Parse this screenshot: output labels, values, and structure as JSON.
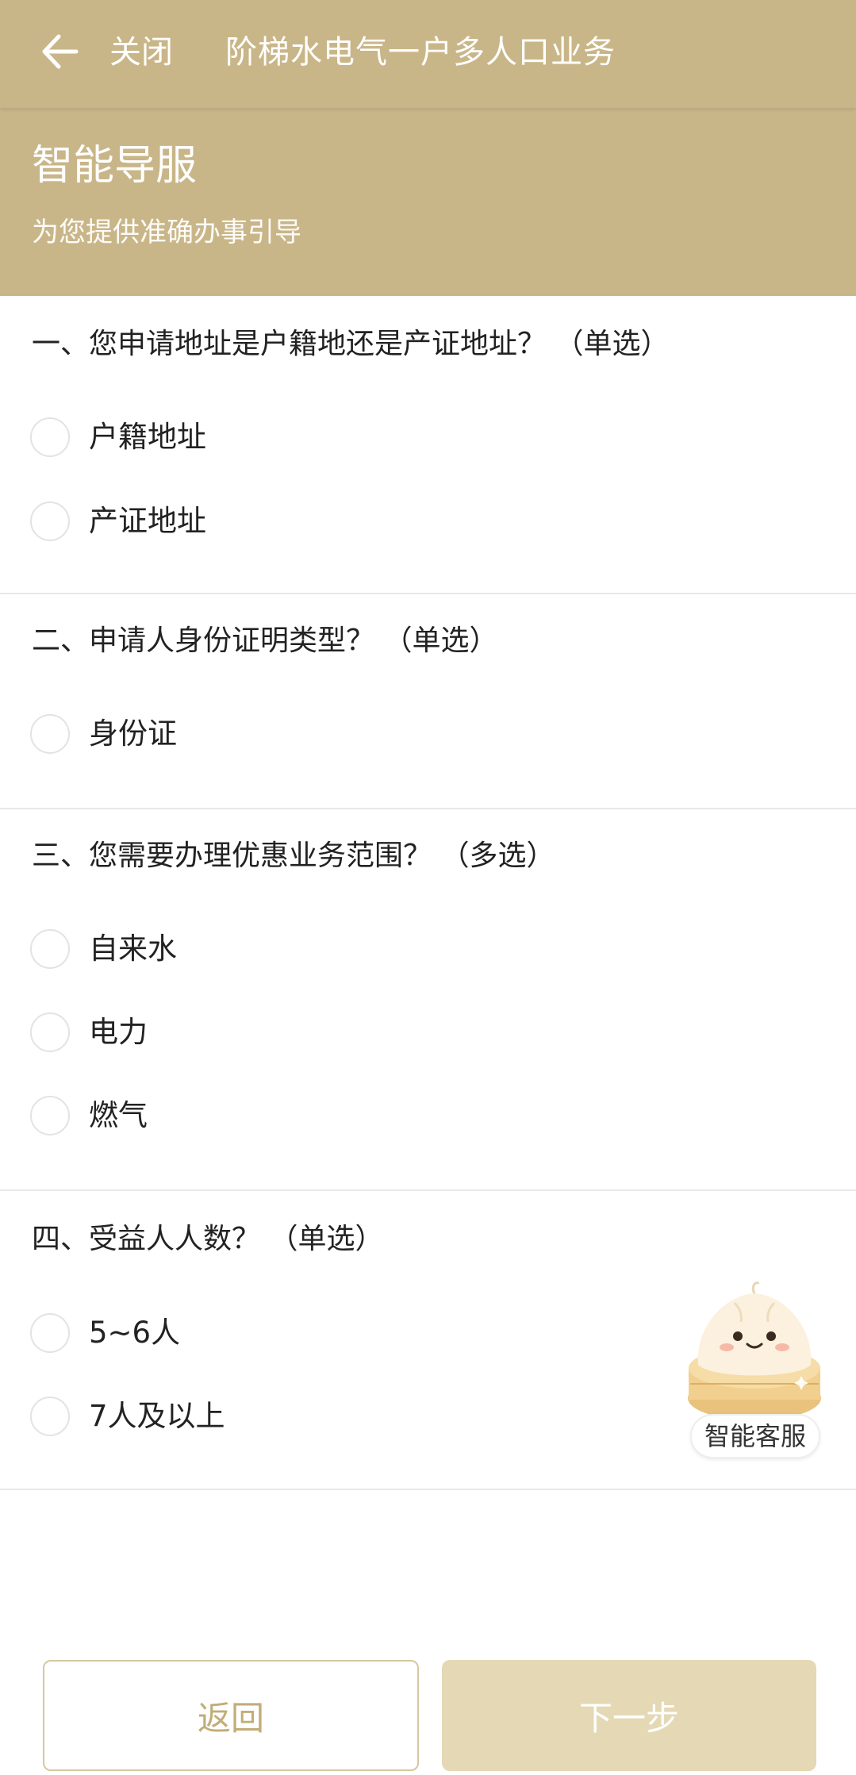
{
  "header": {
    "close_label": "关闭",
    "title": "阶梯水电气一户多人口业务",
    "back_icon": "arrow-left-icon"
  },
  "hero": {
    "title": "智能导服",
    "subtitle": "为您提供准确办事引导"
  },
  "questions": [
    {
      "title": "一、您申请地址是户籍地还是产证地址？ （单选）",
      "options": [
        "户籍地址",
        "产证地址"
      ]
    },
    {
      "title": "二、申请人身份证明类型？ （单选）",
      "options": [
        "身份证"
      ]
    },
    {
      "title": "三、您需要办理优惠业务范围？ （多选）",
      "options": [
        "自来水",
        "电力",
        "燃气"
      ]
    },
    {
      "title": "四、受益人人数？ （单选）",
      "options": [
        "5~6人",
        "7人及以上"
      ]
    }
  ],
  "assistant": {
    "label": "智能客服",
    "icon": "steamed-bun-mascot-icon"
  },
  "footer": {
    "back_label": "返回",
    "next_label": "下一步"
  },
  "colors": {
    "header_bg": "#c9b688",
    "primary_disabled": "#e5d8b5",
    "back_border": "#d6c7a0",
    "back_text": "#c2ad78"
  }
}
